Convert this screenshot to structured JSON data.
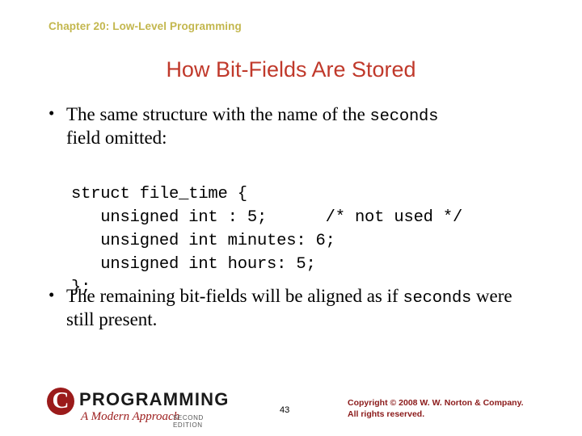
{
  "header": {
    "chapter": "Chapter 20: Low-Level Programming"
  },
  "title": "How Bit-Fields Are Stored",
  "bullets": [
    {
      "marker": "•",
      "text_part1": "The same structure with the name of the ",
      "mono_part": "seconds",
      "text_part2": " field omitted:"
    },
    {
      "marker": "•",
      "text_part1": "The remaining bit-fields will be aligned as if ",
      "mono_part": "seconds",
      "text_part2": " were still present."
    }
  ],
  "code": "struct file_time {\n   unsigned int : 5;      /* not used */\n   unsigned int minutes: 6;\n   unsigned int hours: 5;\n};",
  "footer": {
    "logo_letter": "C",
    "logo_word": "PROGRAMMING",
    "logo_subtitle": "A Modern Approach",
    "logo_edition": "SECOND EDITION",
    "page_number": "43",
    "copyright_line1": "Copyright © 2008 W. W. Norton & Company.",
    "copyright_line2": "All rights reserved."
  },
  "colors": {
    "chapter": "#c3b74e",
    "title": "#c0392b",
    "copyright": "#8b1a1a",
    "logo_red": "#9b1b1b"
  }
}
